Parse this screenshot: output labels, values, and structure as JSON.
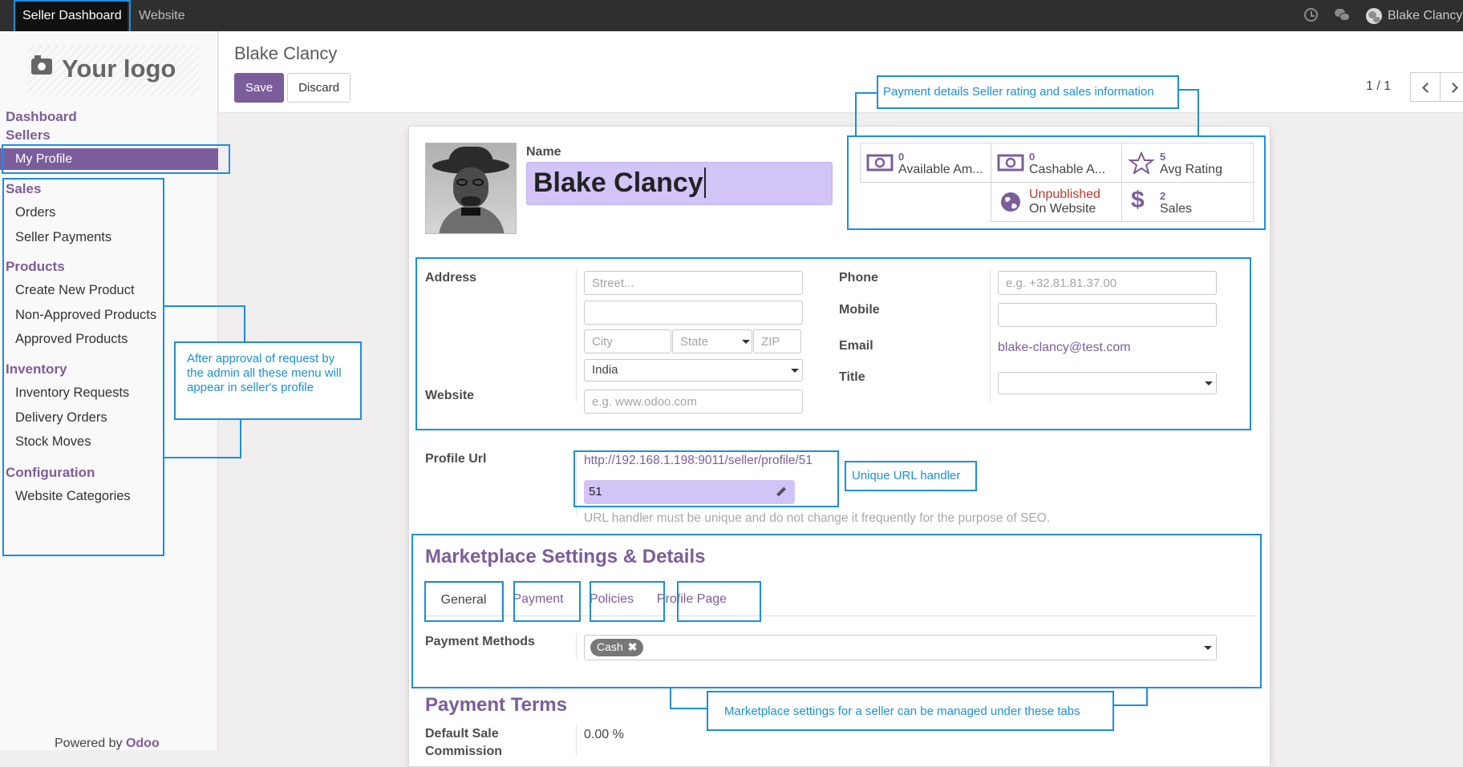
{
  "topbar": {
    "nav_active": "Seller Dashboard",
    "nav_website": "Website",
    "user_name": "Blake Clancy",
    "clock_icon": "clock-icon",
    "chat_icon": "chat-icon"
  },
  "sidebar": {
    "logo_text": "Your logo",
    "dashboard": "Dashboard",
    "sellers": "Sellers",
    "my_profile": "My Profile",
    "sales": "Sales",
    "orders": "Orders",
    "seller_payments": "Seller Payments",
    "products": "Products",
    "create_new_product": "Create New Product",
    "non_approved_products": "Non-Approved Products",
    "approved_products": "Approved Products",
    "inventory": "Inventory",
    "inventory_requests": "Inventory Requests",
    "delivery_orders": "Delivery Orders",
    "stock_moves": "Stock Moves",
    "configuration": "Configuration",
    "website_categories": "Website Categories",
    "powered_by": "Powered by",
    "odoo": "Odoo"
  },
  "header": {
    "breadcrumb": "Blake Clancy",
    "save": "Save",
    "discard": "Discard",
    "pager": "1 / 1"
  },
  "form": {
    "name_label": "Name",
    "name_value": "Blake Clancy",
    "stats": {
      "available_amount_value": "0",
      "available_amount_label": "Available Am...",
      "cashable_amount_value": "0",
      "cashable_amount_label": "Cashable A...",
      "avg_rating_value": "5",
      "avg_rating_label": "Avg Rating",
      "website_status": "Unpublished",
      "website_label": "On Website",
      "sales_value": "2",
      "sales_label": "Sales"
    },
    "address_label": "Address",
    "street_placeholder": "Street...",
    "city_placeholder": "City",
    "state_placeholder": "State",
    "zip_placeholder": "ZIP",
    "country_value": "India",
    "website_label": "Website",
    "website_placeholder": "e.g. www.odoo.com",
    "phone_label": "Phone",
    "phone_placeholder": "e.g. +32.81.81.37.00",
    "mobile_label": "Mobile",
    "email_label": "Email",
    "email_value": "blake-clancy@test.com",
    "title_label": "Title",
    "profile_url_label": "Profile Url",
    "profile_url_value": "http://192.168.1.198:9011/seller/profile/51",
    "url_handler_value": "51",
    "url_help": "URL handler must be unique and do not change it frequently for the purpose of SEO.",
    "marketplace_title": "Marketplace Settings & Details",
    "tabs": [
      "General",
      "Payment",
      "Policies",
      "Profile Page"
    ],
    "payment_methods_label": "Payment Methods",
    "payment_method_tag": "Cash",
    "payment_terms_title": "Payment Terms",
    "default_sale_commission_label": "Default Sale Commission",
    "default_sale_commission_value": "0.00 %"
  },
  "annotations": {
    "payment_details": "Payment details Seller rating and sales information",
    "menu_note": "After approval of request by the admin all these menu will appear in seller's profile",
    "unique_url": "Unique URL handler",
    "marketplace_note": "Marketplace settings for a seller can be managed under these tabs"
  },
  "colors": {
    "brand_purple": "#7c5d9b",
    "annotation_blue": "#1a8fe0",
    "unpublished_red": "#c0392b"
  }
}
